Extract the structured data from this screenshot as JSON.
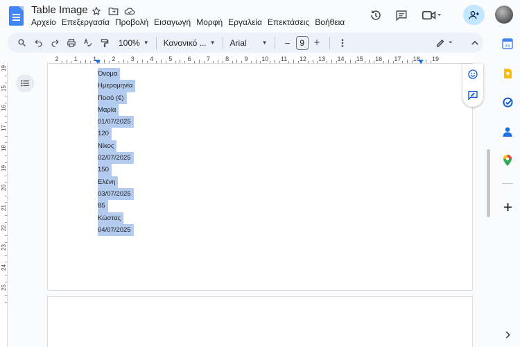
{
  "document": {
    "title": "Table Image"
  },
  "menu": [
    "Αρχείο",
    "Επεξεργασία",
    "Προβολή",
    "Εισαγωγή",
    "Μορφή",
    "Εργαλεία",
    "Επεκτάσεις",
    "Βοήθεια"
  ],
  "toolbar": {
    "zoom": "100%",
    "style": "Κανονικό ...",
    "font": "Arial",
    "font_size": "9",
    "minus": "−",
    "plus": "+"
  },
  "ruler": {
    "numbers": [
      "2",
      "1",
      "1",
      "2",
      "3",
      "4",
      "5",
      "6",
      "7",
      "8",
      "9",
      "10",
      "11",
      "12",
      "13",
      "14",
      "15",
      "16",
      "17",
      "18",
      "19"
    ],
    "vertical_numbers": [
      "19",
      "15",
      "16",
      "17",
      "18",
      "19",
      "20",
      "21",
      "22",
      "23",
      "24",
      "25"
    ]
  },
  "content": {
    "lines": [
      "Όνομα",
      "Ημερομηνία",
      "Ποσό (€)",
      "Μαρία",
      "01/07/2025",
      "120",
      "Νίκος",
      "02/07/2025",
      "150",
      "Ελένη",
      "03/07/2025",
      "85",
      "Κώστας",
      "04/07/2025"
    ]
  },
  "colors": {
    "selection": "#b4cbf0",
    "accent": "#1a73e8",
    "share_bg": "#c2e7ff",
    "toolbar_bg": "#edf2fa"
  },
  "icons": {
    "header": [
      "star-icon",
      "move-to-folder-icon",
      "cloud-saved-icon",
      "history-icon",
      "comments-icon",
      "meet-icon",
      "share-person-add-icon"
    ],
    "rail": [
      "calendar-icon",
      "keep-icon",
      "tasks-icon",
      "contacts-icon",
      "maps-icon",
      "add-icon",
      "expand-icon"
    ]
  }
}
